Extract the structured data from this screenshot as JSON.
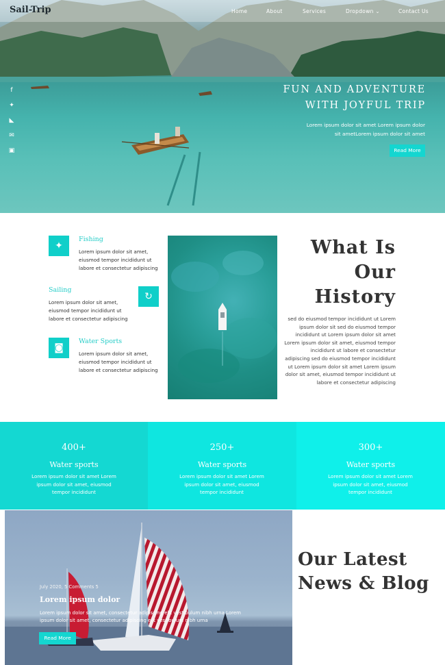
{
  "header": {
    "brand": "Sail-Trip",
    "nav": [
      "Home",
      "About",
      "Services",
      "Dropdown",
      "Contact Us"
    ]
  },
  "social": [
    "facebook-icon",
    "twitter-icon",
    "rss-icon",
    "envelope-icon",
    "instagram-icon"
  ],
  "hero": {
    "title_line1": "FUN AND ADVENTURE",
    "title_line2": "WITH JOYFUL TRIP",
    "text_line1": "Lorem ipsum dolor sit amet Lorem ipsum dolor",
    "text_line2": "sit ametLorem ipsum dolor sit amet",
    "button": "Read More"
  },
  "services": [
    {
      "title": "Fishing",
      "icon": "handshake-icon",
      "lines": [
        "Lorem ipsum dolor sit amet,",
        "eiusmod tempor incididunt ut",
        "labore et consectetur adipiscing"
      ]
    },
    {
      "title": "Sailing",
      "icon": "refresh-icon",
      "lines": [
        "Lorem ipsum dolor sit amet,",
        "eiusmod tempor incididunt ut",
        "labore et consectetur adipiscing"
      ]
    },
    {
      "title": "Water Sports",
      "icon": "binoculars-icon",
      "lines": [
        "Lorem ipsum dolor sit amet,",
        "eiusmod tempor incididunt ut",
        "labore et consectetur adipiscing"
      ]
    }
  ],
  "history": {
    "title_line1": "What Is",
    "title_line2": "Our",
    "title_line3": "History",
    "lines": [
      "sed do eiusmod tempor incididunt ut Lorem",
      "ipsum dolor sit sed do eiusmod tempor",
      "incididunt ut Lorem ipsum dolor sit amet",
      "Lorem ipsum dolor sit amet, eiusmod tempor",
      "incididunt ut labore et consectetur",
      "adipiscing sed do eiusmod tempor incididunt",
      "ut Lorem ipsum dolor sit amet Lorem ipsum",
      "dolor sit amet, eiusmod tempor incididunt ut",
      "labore et consectetur adipiscing"
    ]
  },
  "stats": [
    {
      "number": "400+",
      "title": "Water sports",
      "lines": [
        "Lorem ipsum dolor sit amet Lorem",
        "ipsum dolor sit amet, eiusmod",
        "tempor incididunt"
      ],
      "color": "#14d8d2"
    },
    {
      "number": "250+",
      "title": "Water sports",
      "lines": [
        "Lorem ipsum dolor sit amet Lorem",
        "ipsum dolor sit amet, eiusmod",
        "tempor incididunt"
      ],
      "color": "#0fe6e0"
    },
    {
      "number": "300+",
      "title": "Water sports",
      "lines": [
        "Lorem ipsum dolor sit amet Lorem",
        "ipsum dolor sit amet, eiusmod",
        "tempor incididunt"
      ],
      "color": "#0ff0ea"
    }
  ],
  "blog": {
    "title_line1": "Our Latest",
    "title_line2": "News & Blog",
    "meta": "July 2020, 5 Comments 5",
    "post_title": "Lorem ipsum dolor",
    "text_line1": "Lorem ipsum dolor sit amet, consectetur adipiscing elit vestibulum nibh urna Lorem",
    "text_line2": "ipsum dolor sit amet, consectetur adipiscing elit vestibulum nibh urna",
    "button": "Read More"
  },
  "colors": {
    "accent": "#14d6d0",
    "heading": "#333333",
    "service_title": "#27cdc8"
  }
}
